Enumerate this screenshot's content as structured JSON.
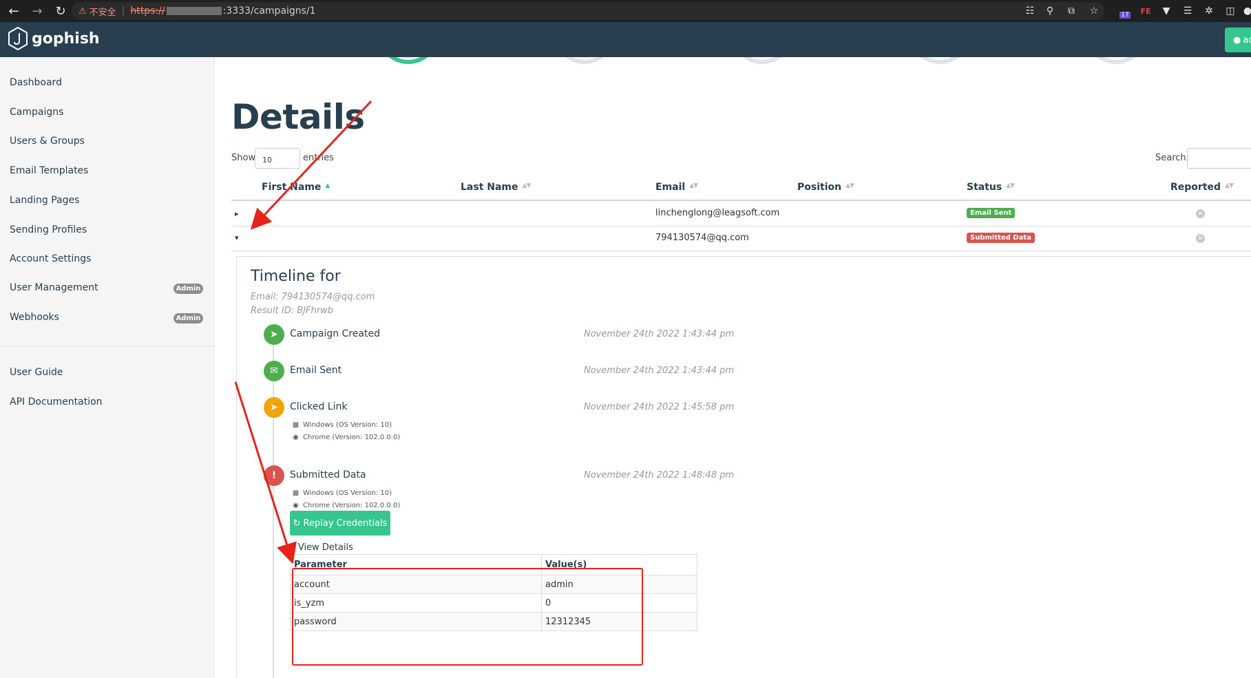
{
  "browser": {
    "security_label": "不安全",
    "url_scheme": "https://",
    "url_rest": ":3333/campaigns/1",
    "ext_badge": "17"
  },
  "topbar": {
    "brand": "gophish",
    "user_button": "ac"
  },
  "sidebar": {
    "items": [
      {
        "label": "Dashboard"
      },
      {
        "label": "Campaigns"
      },
      {
        "label": "Users & Groups"
      },
      {
        "label": "Email Templates"
      },
      {
        "label": "Landing Pages"
      },
      {
        "label": "Sending Profiles"
      },
      {
        "label": "Account Settings"
      },
      {
        "label": "User Management",
        "badge": "Admin"
      },
      {
        "label": "Webhooks",
        "badge": "Admin"
      }
    ],
    "footer_items": [
      {
        "label": "User Guide"
      },
      {
        "label": "API Documentation"
      }
    ]
  },
  "details": {
    "title": "Details",
    "show_label": "Show",
    "page_length": "10",
    "entries_label": "entries",
    "search_label": "Search:",
    "columns": [
      "First Name",
      "Last Name",
      "Email",
      "Position",
      "Status",
      "Reported"
    ],
    "rows": [
      {
        "first": "",
        "last": "",
        "email": "linchenglong@leagsoft.com",
        "position": "",
        "status": "Email Sent"
      },
      {
        "first": "",
        "last": "",
        "email": "794130574@qq.com",
        "position": "",
        "status": "Submitted Data"
      }
    ]
  },
  "timeline": {
    "title": "Timeline for",
    "email_line": "Email: 794130574@qq.com",
    "result_line": "Result ID: BJFhrwb",
    "events": [
      {
        "name": "Campaign Created",
        "time": "November 24th 2022 1:43:44 pm"
      },
      {
        "name": "Email Sent",
        "time": "November 24th 2022 1:43:44 pm"
      },
      {
        "name": "Clicked Link",
        "time": "November 24th 2022 1:45:58 pm",
        "os": "Windows (OS Version: 10)",
        "browser": "Chrome (Version: 102.0.0.0)"
      },
      {
        "name": "Submitted Data",
        "time": "November 24th 2022 1:48:48 pm",
        "os": "Windows (OS Version: 10)",
        "browser": "Chrome (Version: 102.0.0.0)"
      }
    ],
    "replay_label": "Replay Credentials",
    "view_details": "View Details",
    "param_headers": [
      "Parameter",
      "Value(s)"
    ],
    "params": [
      {
        "name": "account",
        "value": "admin"
      },
      {
        "name": "is_yzm",
        "value": "0"
      },
      {
        "name": "password",
        "value": "12312345"
      }
    ]
  },
  "colors": {
    "navy": "#283f50",
    "accent": "#37c58f",
    "danger": "#d9534f",
    "warning": "#f0a30a",
    "annotation": "#e8231b"
  }
}
